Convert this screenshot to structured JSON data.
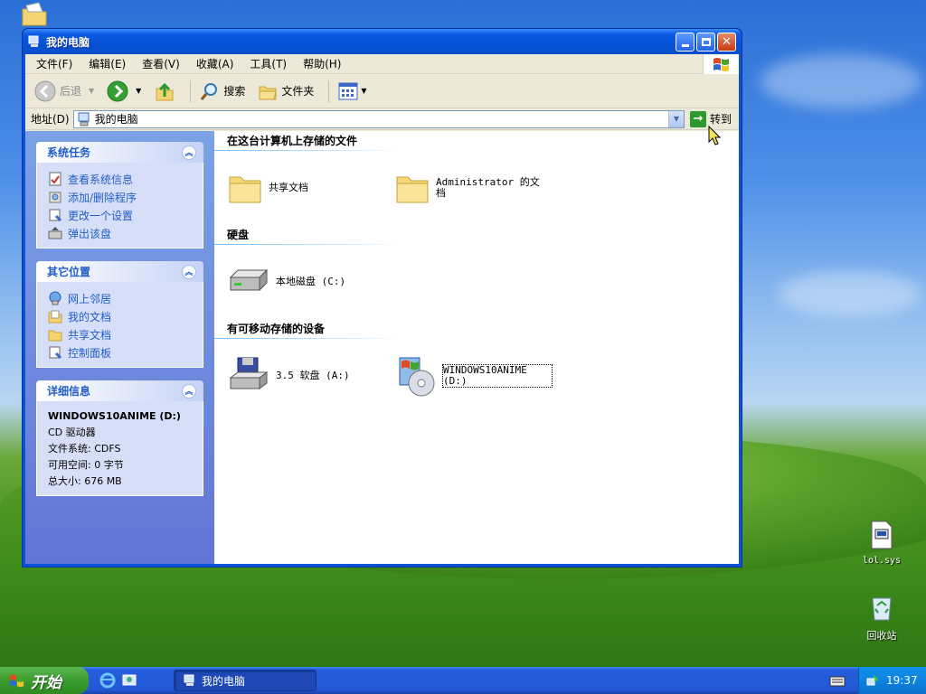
{
  "window": {
    "title": "我的电脑"
  },
  "menu": [
    "文件(F)",
    "编辑(E)",
    "查看(V)",
    "收藏(A)",
    "工具(T)",
    "帮助(H)"
  ],
  "toolbar": {
    "back": "后退",
    "search": "搜索",
    "folders": "文件夹"
  },
  "address": {
    "label": "地址(D)",
    "value": "我的电脑",
    "go": "转到"
  },
  "panels": {
    "system_tasks": {
      "title": "系统任务",
      "items": [
        "查看系统信息",
        "添加/删除程序",
        "更改一个设置",
        "弹出该盘"
      ]
    },
    "other_places": {
      "title": "其它位置",
      "items": [
        "网上邻居",
        "我的文档",
        "共享文档",
        "控制面板"
      ]
    },
    "details": {
      "title": "详细信息",
      "name": "WINDOWS10ANIME (D:)",
      "type": "CD 驱动器",
      "filesystem": "文件系统: CDFS",
      "free": "可用空间: 0 字节",
      "total": "总大小: 676 MB"
    }
  },
  "groups": {
    "stored": {
      "title": "在这台计算机上存储的文件",
      "items": [
        "共享文档",
        "Administrator 的文档"
      ]
    },
    "hdd": {
      "title": "硬盘",
      "items": [
        "本地磁盘 (C:)"
      ]
    },
    "removable": {
      "title": "有可移动存储的设备",
      "items": [
        "3.5 软盘 (A:)",
        "WINDOWS10ANIME (D:)"
      ]
    }
  },
  "desktop": {
    "file": "lol.sys",
    "recycle": "回收站"
  },
  "taskbar": {
    "start": "开始",
    "task": "我的电脑",
    "clock": "19:37"
  }
}
